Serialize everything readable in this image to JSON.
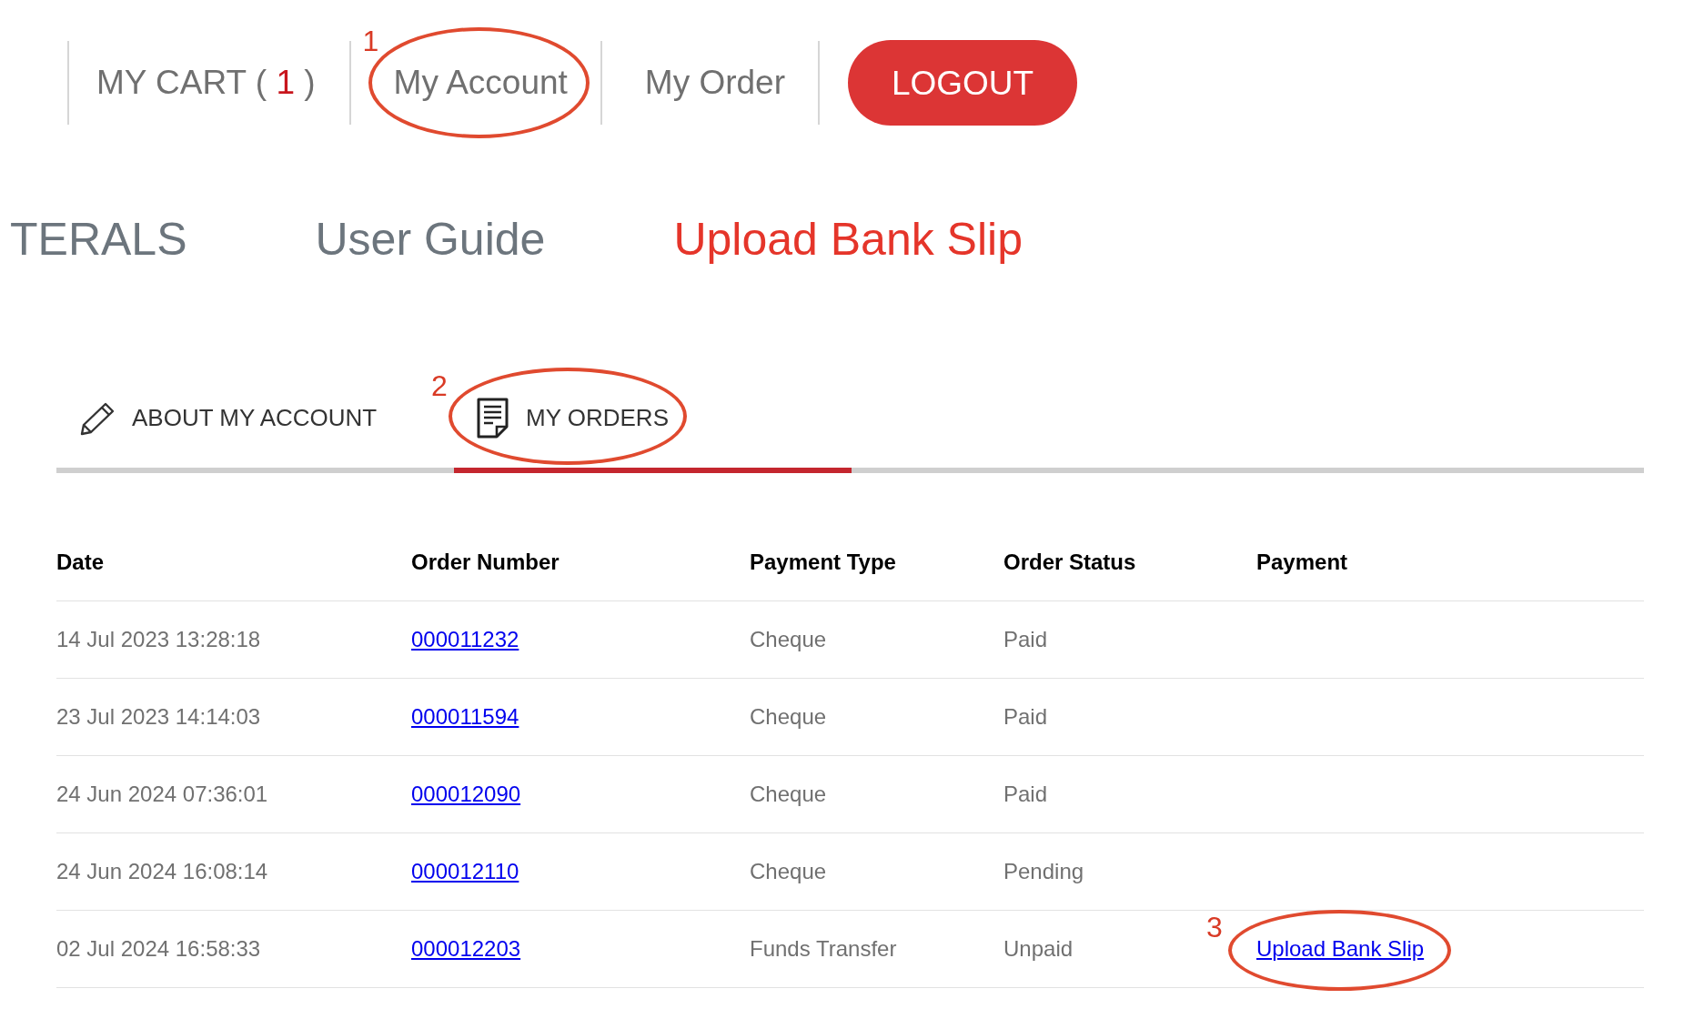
{
  "nav": {
    "items": [
      {
        "kind": "cart",
        "label": "MY CART (",
        "count": "1",
        "label_end": ")"
      },
      {
        "kind": "link",
        "label": "My Account",
        "callout": "1"
      },
      {
        "kind": "link",
        "label": "My Order"
      },
      {
        "kind": "button",
        "label": "LOGOUT"
      }
    ]
  },
  "menu": {
    "items": [
      {
        "label": "TERALS",
        "highlighted": false
      },
      {
        "label": "User Guide",
        "highlighted": false
      },
      {
        "label": "Upload Bank Slip",
        "highlighted": true
      }
    ]
  },
  "tabs": [
    {
      "label": "ABOUT MY ACCOUNT",
      "selected": false
    },
    {
      "label": "MY ORDERS",
      "selected": true,
      "callout": "2"
    }
  ],
  "orders": {
    "columns": [
      "Date",
      "Order Number",
      "Payment Type",
      "Order Status",
      "Payment"
    ],
    "rows": [
      {
        "date": "14 Jul 2023 13:28:18",
        "order_number": "000011232",
        "payment_type": "Cheque",
        "order_status": "Paid"
      },
      {
        "date": "23 Jul 2023 14:14:03",
        "order_number": "000011594",
        "payment_type": "Cheque",
        "order_status": "Paid"
      },
      {
        "date": "24 Jun 2024 07:36:01",
        "order_number": "000012090",
        "payment_type": "Cheque",
        "order_status": "Paid"
      },
      {
        "date": "24 Jun 2024 16:08:14",
        "order_number": "000012110",
        "payment_type": "Cheque",
        "order_status": "Pending"
      },
      {
        "date": "02 Jul 2024 16:58:33",
        "order_number": "000012203",
        "payment_type": "Funds Transfer",
        "order_status": "Unpaid",
        "payment": {
          "label": "Upload Bank Slip",
          "callout": "3"
        }
      }
    ]
  }
}
